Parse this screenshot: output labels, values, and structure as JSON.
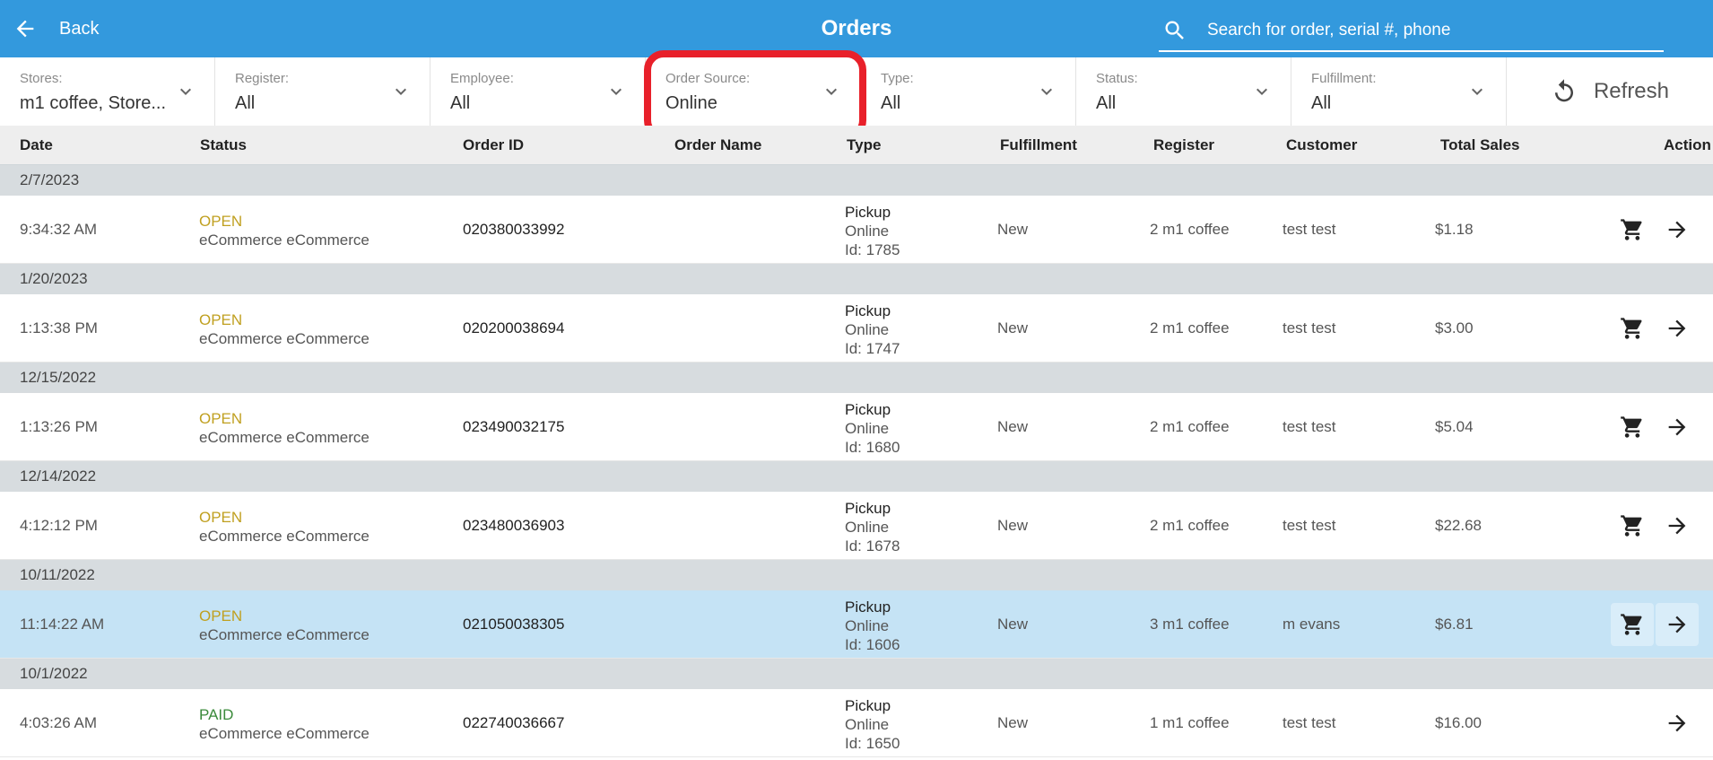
{
  "header": {
    "back_label": "Back",
    "title": "Orders",
    "search_placeholder": "Search for order, serial #, phone",
    "bg_color": "#3399dd"
  },
  "filters": [
    {
      "label": "Stores:",
      "value": "m1 coffee, Store..."
    },
    {
      "label": "Register:",
      "value": "All"
    },
    {
      "label": "Employee:",
      "value": "All"
    },
    {
      "label": "Order Source:",
      "value": "Online"
    },
    {
      "label": "Type:",
      "value": "All"
    },
    {
      "label": "Status:",
      "value": "All"
    },
    {
      "label": "Fulfillment:",
      "value": "All"
    }
  ],
  "refresh_label": "Refresh",
  "columns": [
    "Date",
    "Status",
    "Order ID",
    "Order Name",
    "Type",
    "Fulfillment",
    "Register",
    "Customer",
    "Total Sales",
    "Action"
  ],
  "groups": [
    {
      "date": "2/7/2023",
      "order": {
        "time": "9:34:32 AM",
        "status": "OPEN",
        "source": "eCommerce eCommerce",
        "order_id": "020380033992",
        "order_name": "",
        "type": "Pickup",
        "type_source": "Online",
        "type_id": "Id: 1785",
        "fulfillment": "New",
        "register": "2  m1 coffee",
        "customer": "test test",
        "total": "$1.18"
      }
    },
    {
      "date": "1/20/2023",
      "order": {
        "time": "1:13:38 PM",
        "status": "OPEN",
        "source": "eCommerce eCommerce",
        "order_id": "020200038694",
        "order_name": "",
        "type": "Pickup",
        "type_source": "Online",
        "type_id": "Id: 1747",
        "fulfillment": "New",
        "register": "2  m1 coffee",
        "customer": "test test",
        "total": "$3.00"
      }
    },
    {
      "date": "12/15/2022",
      "order": {
        "time": "1:13:26 PM",
        "status": "OPEN",
        "source": "eCommerce eCommerce",
        "order_id": "023490032175",
        "order_name": "",
        "type": "Pickup",
        "type_source": "Online",
        "type_id": "Id: 1680",
        "fulfillment": "New",
        "register": "2  m1 coffee",
        "customer": "test test",
        "total": "$5.04"
      }
    },
    {
      "date": "12/14/2022",
      "order": {
        "time": "4:12:12 PM",
        "status": "OPEN",
        "source": "eCommerce eCommerce",
        "order_id": "023480036903",
        "order_name": "",
        "type": "Pickup",
        "type_source": "Online",
        "type_id": "Id: 1678",
        "fulfillment": "New",
        "register": "2  m1 coffee",
        "customer": "test test",
        "total": "$22.68"
      }
    },
    {
      "date": "10/11/2022",
      "order": {
        "time": "11:14:22 AM",
        "status": "OPEN",
        "source": "eCommerce eCommerce",
        "order_id": "021050038305",
        "order_name": "",
        "type": "Pickup",
        "type_source": "Online",
        "type_id": "Id: 1606",
        "fulfillment": "New",
        "register": "3  m1 coffee",
        "customer": "m evans",
        "total": "$6.81"
      }
    },
    {
      "date": "10/1/2022",
      "order": {
        "time": "4:03:26 AM",
        "status": "PAID",
        "source": "eCommerce eCommerce",
        "order_id": "022740036667",
        "order_name": "",
        "type": "Pickup",
        "type_source": "Online",
        "type_id": "Id: 1650",
        "fulfillment": "New",
        "register": "1  m1 coffee",
        "customer": "test test",
        "total": "$16.00"
      }
    }
  ],
  "selected_row": 4,
  "icons": {
    "back": "arrow-left-icon",
    "search": "search-icon",
    "chevron": "chevron-down-icon",
    "refresh": "refresh-icon",
    "cart": "cart-icon",
    "open": "arrow-right-icon"
  },
  "colors": {
    "status_open": "#c0a020",
    "status_paid": "#3a8a3a",
    "highlight": "#e8202a",
    "selected_row": "#c5e3f5"
  }
}
